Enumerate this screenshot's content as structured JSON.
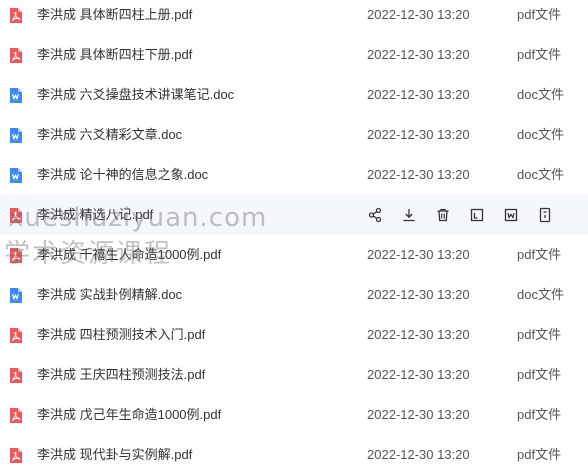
{
  "files": [
    {
      "name": "李洪成 具体断四柱上册.pdf",
      "date": "2022-12-30 13:20",
      "type": "pdf文件",
      "icon": "pdf-icon"
    },
    {
      "name": "李洪成 具体断四柱下册.pdf",
      "date": "2022-12-30 13:20",
      "type": "pdf文件",
      "icon": "pdf-icon"
    },
    {
      "name": "李洪成 六爻操盘技术讲课笔记.doc",
      "date": "2022-12-30 13:20",
      "type": "doc文件",
      "icon": "word-icon"
    },
    {
      "name": "李洪成 六爻精彩文章.doc",
      "date": "2022-12-30 13:20",
      "type": "doc文件",
      "icon": "word-icon"
    },
    {
      "name": "李洪成 论十神的信息之象.doc",
      "date": "2022-12-30 13:20",
      "type": "doc文件",
      "icon": "word-icon"
    },
    {
      "name": "李洪成 精选八记.pdf",
      "date": "",
      "type": "",
      "icon": "pdf-icon",
      "hovered": true
    },
    {
      "name": "李洪成 千禧生人命造1000例.pdf",
      "date": "2022-12-30 13:20",
      "type": "pdf文件",
      "icon": "pdf-icon"
    },
    {
      "name": "李洪成 实战卦例精解.doc",
      "date": "2022-12-30 13:20",
      "type": "doc文件",
      "icon": "word-icon"
    },
    {
      "name": "李洪成 四柱预测技术入门.pdf",
      "date": "2022-12-30 13:20",
      "type": "pdf文件",
      "icon": "pdf-icon"
    },
    {
      "name": "李洪成 王庆四柱预测技法.pdf",
      "date": "2022-12-30 13:20",
      "type": "pdf文件",
      "icon": "pdf-icon"
    },
    {
      "name": "李洪成 戊己年生命造1000例.pdf",
      "date": "2022-12-30 13:20",
      "type": "pdf文件",
      "icon": "pdf-icon"
    },
    {
      "name": "李洪成 现代卦与实例解.pdf",
      "date": "2022-12-30 13:20",
      "type": "pdf文件",
      "icon": "pdf-icon"
    }
  ],
  "hover_actions": [
    "share-icon",
    "download-icon",
    "delete-icon",
    "copy-icon",
    "word-convert-icon",
    "more-icon"
  ],
  "watermark": {
    "line1": "xueshuziyuan.com",
    "line2": "学术资源课程"
  },
  "colors": {
    "pdf": "#f0585a",
    "word": "#3d8af7",
    "hover_bg": "#f4f7fc",
    "text": "#333333"
  }
}
